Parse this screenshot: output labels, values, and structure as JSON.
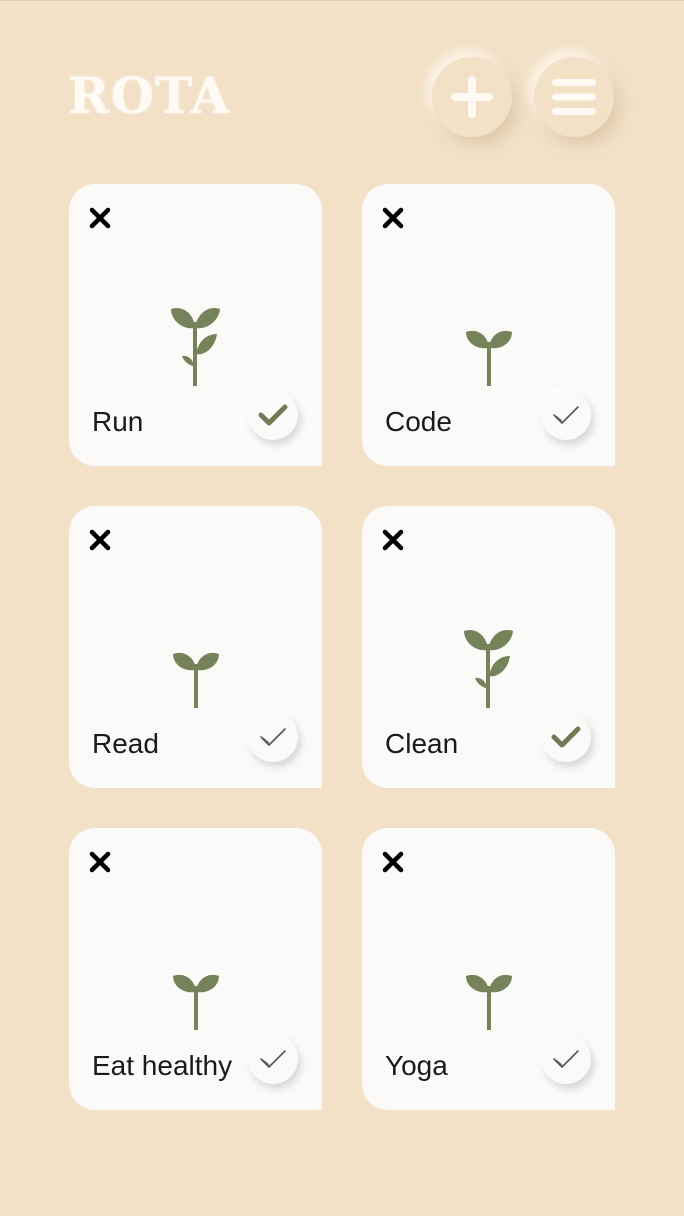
{
  "app": {
    "title": "ROTA"
  },
  "colors": {
    "background": "#f2e0c7",
    "card": "#fcfaf8",
    "plant": "#76825a",
    "check_done": "#6f7b55"
  },
  "header": {
    "add_icon": "plus-icon",
    "menu_icon": "hamburger-icon"
  },
  "habits": [
    {
      "name": "Run",
      "plant_stage": "large",
      "completed": true
    },
    {
      "name": "Code",
      "plant_stage": "small",
      "completed": false
    },
    {
      "name": "Read",
      "plant_stage": "small",
      "completed": false
    },
    {
      "name": "Clean",
      "plant_stage": "large",
      "completed": true
    },
    {
      "name": "Eat healthy",
      "plant_stage": "small",
      "completed": false
    },
    {
      "name": "Yoga",
      "plant_stage": "small",
      "completed": false
    }
  ]
}
